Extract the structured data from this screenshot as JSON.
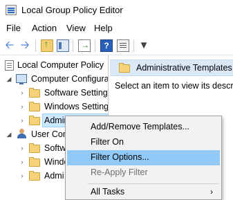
{
  "window": {
    "title": "Local Group Policy Editor"
  },
  "menu": [
    {
      "label": "File"
    },
    {
      "label": "Action"
    },
    {
      "label": "View"
    },
    {
      "label": "Help"
    }
  ],
  "toolbar": {
    "icons": [
      "back-arrow-icon",
      "forward-arrow-icon",
      "up-folder-icon",
      "show-hide-pane-icon",
      "export-list-icon",
      "help-icon",
      "properties-icon",
      "filter-icon"
    ]
  },
  "tree": {
    "root": "Local Computer Policy",
    "computer_config": "Computer Configura",
    "software_settings": "Software Settings",
    "windows_settings": "Windows Setting",
    "admin_templates": "Administrative Te",
    "user_config": "User Conf",
    "user_software": "Softw",
    "user_windows": "Windo",
    "user_admin": "Admi"
  },
  "right_pane": {
    "header": "Administrative Templates",
    "body": "Select an item to view its description."
  },
  "context_menu": {
    "items": [
      {
        "label": "Add/Remove Templates..."
      },
      {
        "label": "Filter On"
      },
      {
        "label": "Filter Options..."
      },
      {
        "label": "Re-Apply Filter"
      },
      {
        "label": "All Tasks"
      }
    ],
    "submenu_arrow": "›",
    "highlighted": "Filter Options...",
    "disabled": "Re-Apply Filter"
  },
  "colors": {
    "selection_tree": "#cce8ff",
    "context_hover": "#91c9f7",
    "right_header": "#dbe9f7"
  }
}
